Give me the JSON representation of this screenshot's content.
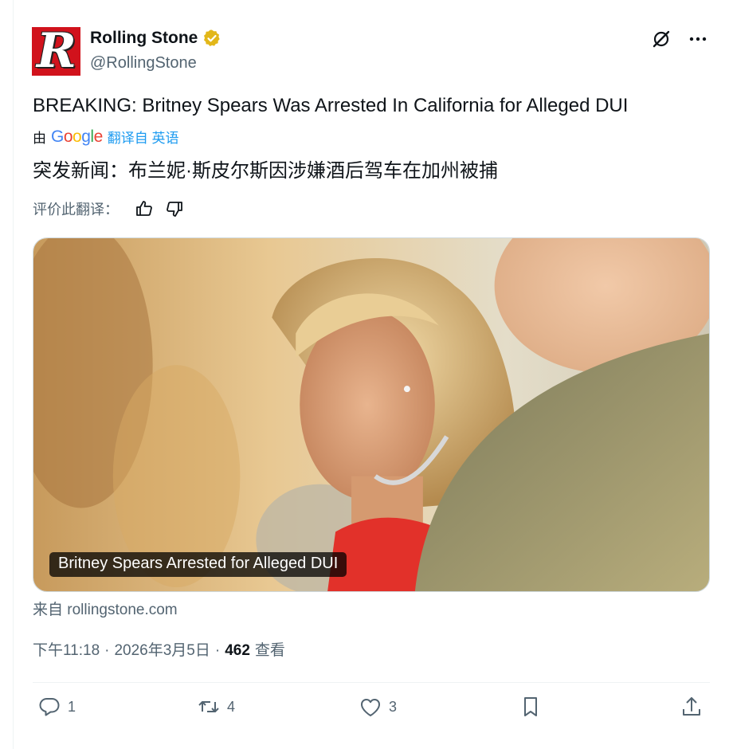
{
  "account": {
    "name": "Rolling Stone",
    "handle": "@RollingStone",
    "avatar_letter": "R",
    "verified_badge_color": "#e2b719"
  },
  "tweet": {
    "text": "BREAKING: Britney Spears Was Arrested In California for Alleged DUI",
    "translated_by_prefix": "由",
    "google_letters": [
      "G",
      "o",
      "o",
      "g",
      "l",
      "e"
    ],
    "translate_link": "翻译自 英语",
    "translated_text": "突发新闻：布兰妮·斯皮尔斯因涉嫌酒后驾车在加州被捕",
    "rate_label": "评价此翻译：",
    "card_title": "Britney Spears Arrested for Alleged DUI",
    "source": "来自 rollingstone.com",
    "time": "下午11:18",
    "sep1": "·",
    "date": "2026年3月5日",
    "sep2": "·",
    "views_count": "462",
    "views_label": "查看"
  },
  "actions": {
    "reply_count": "1",
    "retweet_count": "4",
    "like_count": "3"
  },
  "icons": [
    "grok-icon",
    "more-icon",
    "thumbs-up-icon",
    "thumbs-down-icon",
    "reply-icon",
    "retweet-icon",
    "like-icon",
    "bookmark-icon",
    "share-icon"
  ],
  "colors": {
    "text_primary": "#0f1419",
    "text_secondary": "#536471",
    "link": "#1d9bf0",
    "google_blue": "#4285f4",
    "google_red": "#ea4335",
    "google_yellow": "#fbbc05",
    "google_green": "#34a853"
  }
}
